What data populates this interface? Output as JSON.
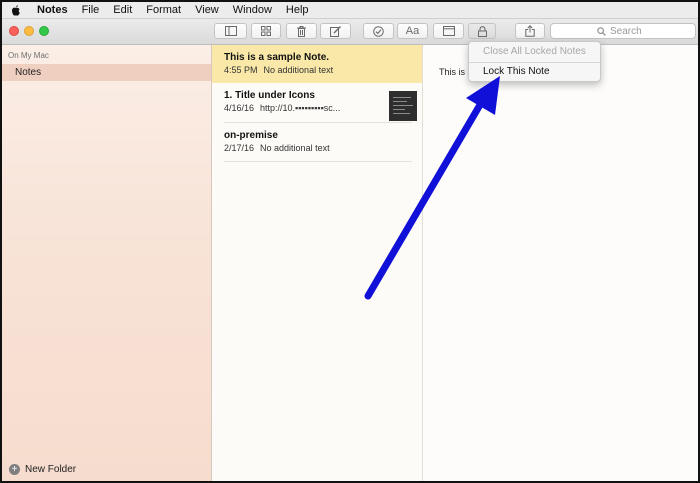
{
  "menubar": {
    "items": [
      "Notes",
      "File",
      "Edit",
      "Format",
      "View",
      "Window",
      "Help"
    ]
  },
  "toolbar": {
    "format_label": "Aa",
    "search_placeholder": "Search"
  },
  "sidebar": {
    "header": "On My Mac",
    "folder": "Notes",
    "new_folder_label": "New Folder"
  },
  "notes": [
    {
      "title": "This is a sample Note.",
      "date": "4:55 PM",
      "preview": "No additional text"
    },
    {
      "title": "1. Title under Icons",
      "date": "4/16/16",
      "preview": "http://10.▪▪▪▪▪▪▪▪▪sc..."
    },
    {
      "title": "on-premise",
      "date": "2/17/16",
      "preview": "No additional text"
    }
  ],
  "editor": {
    "body_text": "This is a"
  },
  "lock_menu": {
    "close_all": "Close All Locked Notes",
    "lock_note": "Lock This Note"
  },
  "colors": {
    "selected_note": "#f9e8a8",
    "sidebar_selected": "#efcfbf",
    "annotation_arrow": "#1010d8"
  }
}
